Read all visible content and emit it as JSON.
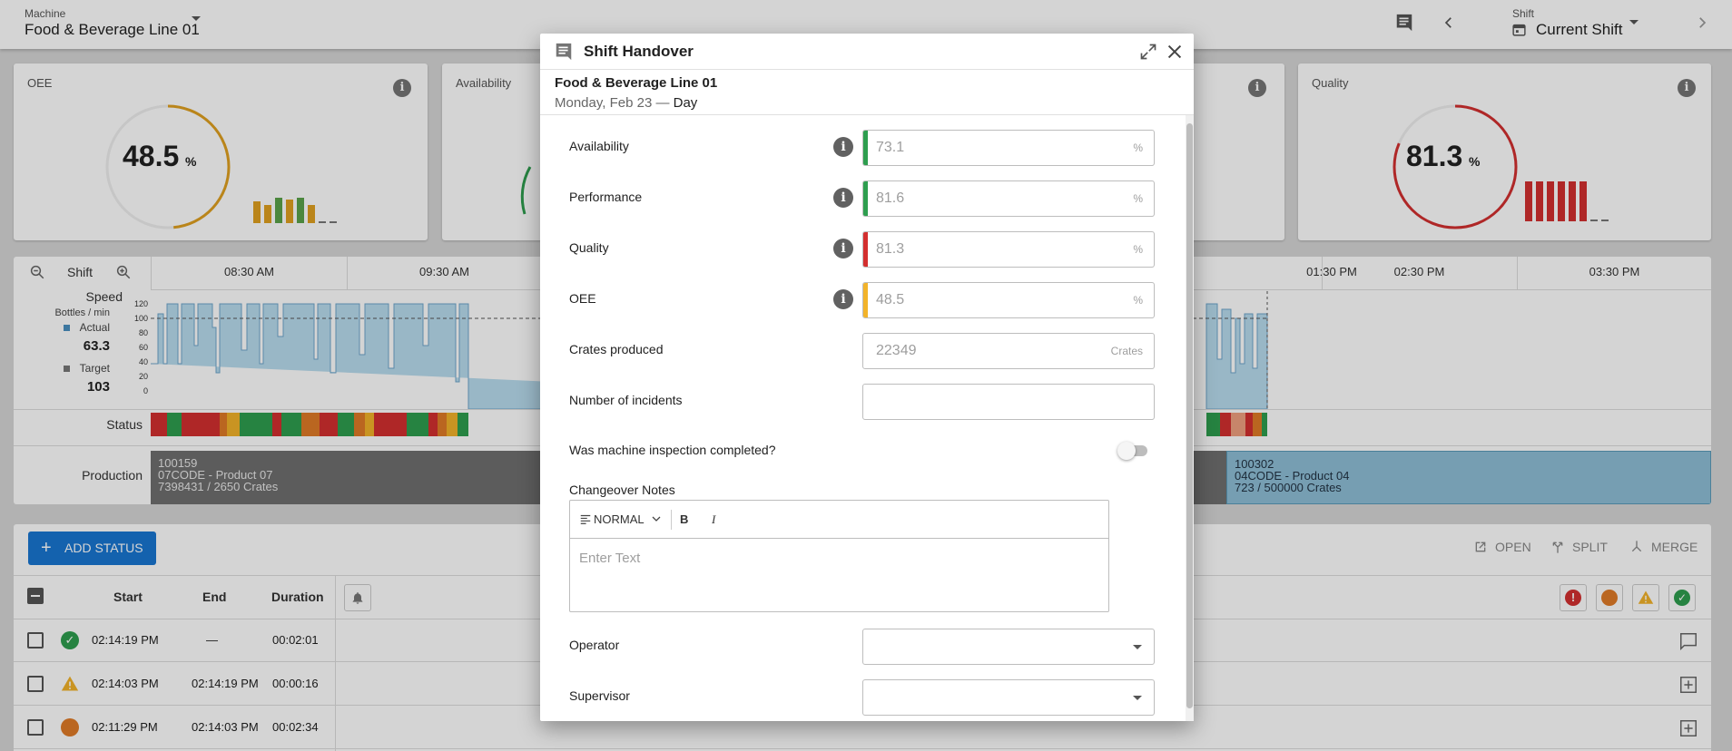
{
  "topbar": {
    "machine_label": "Machine",
    "machine_value": "Food & Beverage Line 01",
    "shift_label": "Shift",
    "shift_value": "Current Shift"
  },
  "kpis": {
    "oee": {
      "label": "OEE",
      "value": "48.5",
      "unit": "%",
      "color": "#e0a020",
      "fraction": 0.485
    },
    "availability": {
      "label": "Availability"
    },
    "quality": {
      "label": "Quality",
      "value": "81.3",
      "unit": "%",
      "color": "#d32f2f",
      "fraction": 0.813
    }
  },
  "timeline": {
    "scope_label": "Shift",
    "times": [
      "08:30 AM",
      "09:30 AM",
      "01:30 PM",
      "02:30 PM",
      "03:30 PM"
    ],
    "speed_label": "Speed",
    "speed_unit": "Bottles / min",
    "actual_label": "Actual",
    "actual_value": "63.3",
    "target_label": "Target",
    "target_value": "103",
    "y_ticks": [
      "120",
      "100",
      "80",
      "60",
      "40",
      "20",
      "0"
    ],
    "status_label": "Status",
    "production_label": "Production",
    "production_left": {
      "order": "100159",
      "product": "07CODE - Product 07",
      "count": "7398431 / 2650 Crates"
    },
    "production_right": {
      "order": "100302",
      "product": "04CODE - Product 04",
      "count": "723 / 500000 Crates"
    }
  },
  "events": {
    "add_status": "ADD STATUS",
    "open": "OPEN",
    "split": "SPLIT",
    "merge": "MERGE",
    "columns": [
      "Start",
      "End",
      "Duration"
    ],
    "rows": [
      {
        "start": "02:14:19 PM",
        "end": "—",
        "duration": "00:02:01"
      },
      {
        "start": "02:14:03 PM",
        "end": "02:14:19 PM",
        "duration": "00:00:16"
      },
      {
        "start": "02:11:29 PM",
        "end": "02:14:03 PM",
        "duration": "00:02:34"
      }
    ]
  },
  "dialog": {
    "title": "Shift Handover",
    "machine": "Food & Beverage Line 01",
    "date_prefix": "Monday, Feb 23 —",
    "date_shift": "Day",
    "fields": [
      {
        "label": "Availability",
        "value": "73.1",
        "unit": "%",
        "color": "#2e9e4f"
      },
      {
        "label": "Performance",
        "value": "81.6",
        "unit": "%",
        "color": "#2e9e4f"
      },
      {
        "label": "Quality",
        "value": "81.3",
        "unit": "%",
        "color": "#d32f2f"
      },
      {
        "label": "OEE",
        "value": "48.5",
        "unit": "%",
        "color": "#f2b32a"
      }
    ],
    "crates_label": "Crates produced",
    "crates_value": "22349",
    "crates_unit": "Crates",
    "incidents_label": "Number of incidents",
    "inspection_label": "Was machine inspection completed?",
    "notes_label": "Changeover Notes",
    "editor_style": "NORMAL",
    "editor_bold": "B",
    "editor_italic": "I",
    "editor_placeholder": "Enter Text",
    "operator_label": "Operator",
    "supervisor_label": "Supervisor"
  }
}
